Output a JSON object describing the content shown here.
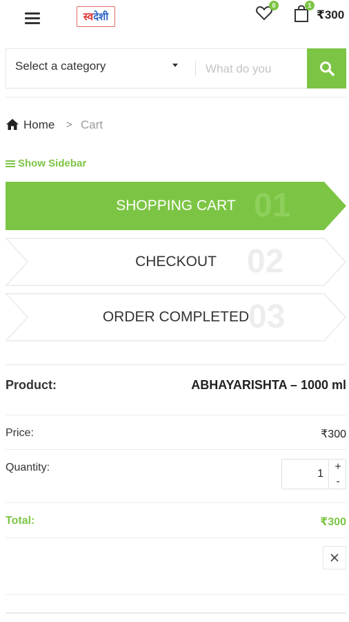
{
  "header": {
    "logo_text_a": "स्व",
    "logo_text_b": "देशी",
    "wishlist_count": "0",
    "cart_count": "1",
    "cart_total": "₹300"
  },
  "search": {
    "category_label": "Select a category",
    "placeholder": "What do you"
  },
  "breadcrumb": {
    "home": "Home",
    "separator": ">",
    "current": "Cart"
  },
  "sidebar_toggle": "Show Sidebar",
  "steps": [
    {
      "label": "SHOPPING CART",
      "number": "01",
      "active": true
    },
    {
      "label": "CHECKOUT",
      "number": "02",
      "active": false
    },
    {
      "label": "ORDER COMPLETED",
      "number": "03",
      "active": false
    }
  ],
  "cart": {
    "product_label": "Product:",
    "product_name": "ABHAYARISHTA – 1000 ml",
    "price_label": "Price:",
    "price_value": "₹300",
    "quantity_label": "Quantity:",
    "quantity_value": "1",
    "qty_plus": "+",
    "qty_minus": "-",
    "total_label": "Total:",
    "total_value": "₹300"
  },
  "colors": {
    "accent": "#7cc544",
    "inactive_step_bg": "#ffffff",
    "step_number_active": "#8fd05c",
    "step_number_inactive": "#ededed"
  },
  "icons": [
    "menu-icon",
    "heart-icon",
    "shopping-bag-icon",
    "search-icon",
    "home-icon",
    "close-icon"
  ]
}
